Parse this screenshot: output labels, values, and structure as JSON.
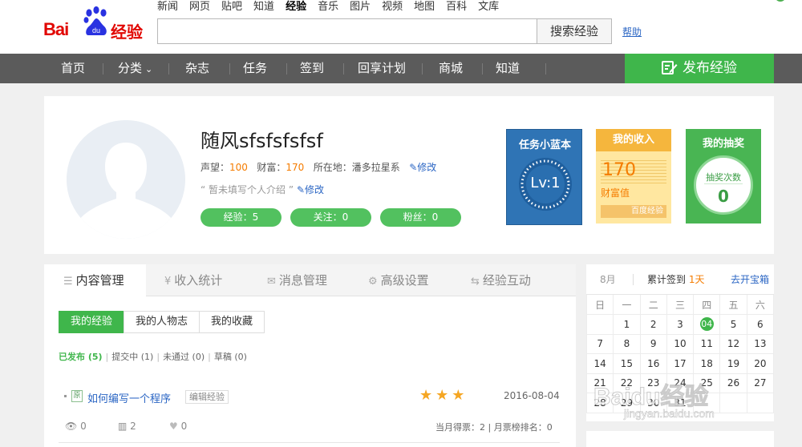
{
  "header": {
    "logo_bai": "Bai",
    "logo_du": "du",
    "logo_jingyan": "经验",
    "top_nav": [
      "新闻",
      "网页",
      "贴吧",
      "知道",
      "经验",
      "音乐",
      "图片",
      "视频",
      "地图",
      "百科",
      "文库"
    ],
    "top_nav_active": "经验",
    "search_placeholder": "",
    "search_button": "搜索经验",
    "help": "帮助"
  },
  "main_nav": {
    "items": [
      "首页",
      "分类",
      "杂志",
      "任务",
      "签到",
      "回享计划",
      "商城",
      "知道"
    ],
    "dropdown_arrow": "⌄",
    "publish": "发布经验"
  },
  "profile": {
    "username": "随风sfsfsfsfsf",
    "reputation_label": "声望：",
    "reputation": "100",
    "wealth_label": "财富：",
    "wealth": "170",
    "location_label": "所在地：",
    "location": "潘多拉星系",
    "edit": "修改",
    "intro": "暂未填写个人介绍",
    "intro_edit": "修改",
    "pills": [
      "经验：5",
      "关注：0",
      "粉丝：0"
    ]
  },
  "cards": {
    "task_title": "任务小蓝本",
    "task_level": "Lv:1",
    "income_title": "我的收入",
    "income_value": "170",
    "income_label": "财富值",
    "income_footer": "百度经验",
    "lottery_title": "我的抽奖",
    "lottery_label": "抽奖次数",
    "lottery_count": "0"
  },
  "content": {
    "tabs": [
      {
        "icon": "☰",
        "label": "内容管理"
      },
      {
        "icon": "¥",
        "label": "收入统计"
      },
      {
        "icon": "✉",
        "label": "消息管理"
      },
      {
        "icon": "⚙",
        "label": "高级设置"
      },
      {
        "icon": "⇆",
        "label": "经验互动"
      }
    ],
    "subtabs": [
      "我的经验",
      "我的人物志",
      "我的收藏"
    ],
    "filters": [
      "已发布 (5)",
      "提交中 (1)",
      "未通过 (0)",
      "草稿 (0)"
    ],
    "entry": {
      "source_badge": "原",
      "title": "如何编写一个程序",
      "edit": "编辑经验",
      "stars": "★★★",
      "date": "2016-08-04",
      "views": "0",
      "bars": "2",
      "likes": "0",
      "rank": "当月得票：2 | 月票榜排名：0"
    }
  },
  "calendar": {
    "month": "8月",
    "streak_label": "累计签到",
    "streak_days": "1天",
    "treasure": "去开宝箱",
    "weekdays": [
      "日",
      "一",
      "二",
      "三",
      "四",
      "五",
      "六"
    ],
    "weeks": [
      [
        "",
        "1",
        "2",
        "3",
        "04",
        "5",
        "6"
      ],
      [
        "7",
        "8",
        "9",
        "10",
        "11",
        "12",
        "13"
      ],
      [
        "14",
        "15",
        "16",
        "17",
        "18",
        "19",
        "20"
      ],
      [
        "21",
        "22",
        "23",
        "24",
        "25",
        "26",
        "27"
      ],
      [
        "28",
        "29",
        "30",
        "31",
        "",
        "",
        ""
      ]
    ],
    "today": "04"
  },
  "watermark": {
    "line1": "Baidu经验",
    "line2": "jingyan.baidu.com"
  }
}
